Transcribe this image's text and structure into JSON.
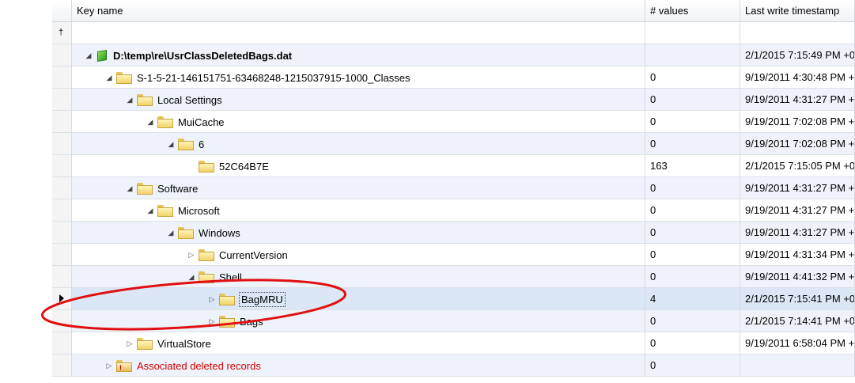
{
  "columns": {
    "key_name": "Key name",
    "values": "# values",
    "timestamp": "Last write timestamp"
  },
  "filter_row": {
    "pin_glyph": "†"
  },
  "rows": [
    {
      "label": "D:\\temp\\re\\UsrClassDeletedBags.dat",
      "values": "",
      "timestamp": "2/1/2015 7:15:49 PM +0...",
      "level": 0,
      "expander": "open",
      "icon": "hive-icon",
      "bold": true,
      "red": false,
      "band": true,
      "selected": false
    },
    {
      "label": "S-1-5-21-146151751-63468248-1215037915-1000_Classes",
      "values": "0",
      "timestamp": "9/19/2011 4:30:48 PM +...",
      "level": 1,
      "expander": "open",
      "icon": "folder-icon",
      "bold": false,
      "red": false,
      "band": false,
      "selected": false
    },
    {
      "label": "Local Settings",
      "values": "0",
      "timestamp": "9/19/2011 4:31:27 PM +...",
      "level": 2,
      "expander": "open",
      "icon": "folder-icon",
      "bold": false,
      "red": false,
      "band": true,
      "selected": false
    },
    {
      "label": "MuiCache",
      "values": "0",
      "timestamp": "9/19/2011 7:02:08 PM +...",
      "level": 3,
      "expander": "open",
      "icon": "folder-icon",
      "bold": false,
      "red": false,
      "band": false,
      "selected": false
    },
    {
      "label": "6",
      "values": "0",
      "timestamp": "9/19/2011 7:02:08 PM +...",
      "level": 4,
      "expander": "open",
      "icon": "folder-icon",
      "bold": false,
      "red": false,
      "band": true,
      "selected": false
    },
    {
      "label": "52C64B7E",
      "values": "163",
      "timestamp": "2/1/2015 7:15:05 PM +0...",
      "level": 5,
      "expander": "none",
      "icon": "folder-icon",
      "bold": false,
      "red": false,
      "band": false,
      "selected": false
    },
    {
      "label": "Software",
      "values": "0",
      "timestamp": "9/19/2011 4:31:27 PM +...",
      "level": 2,
      "expander": "open",
      "icon": "folder-icon",
      "bold": false,
      "red": false,
      "band": true,
      "selected": false
    },
    {
      "label": "Microsoft",
      "values": "0",
      "timestamp": "9/19/2011 4:31:27 PM +...",
      "level": 3,
      "expander": "open",
      "icon": "folder-icon",
      "bold": false,
      "red": false,
      "band": false,
      "selected": false
    },
    {
      "label": "Windows",
      "values": "0",
      "timestamp": "9/19/2011 4:31:27 PM +...",
      "level": 4,
      "expander": "open",
      "icon": "folder-icon",
      "bold": false,
      "red": false,
      "band": true,
      "selected": false
    },
    {
      "label": "CurrentVersion",
      "values": "0",
      "timestamp": "9/19/2011 4:31:34 PM +...",
      "level": 5,
      "expander": "closed",
      "icon": "folder-icon",
      "bold": false,
      "red": false,
      "band": false,
      "selected": false
    },
    {
      "label": "Shell",
      "values": "0",
      "timestamp": "9/19/2011 4:41:32 PM +...",
      "level": 5,
      "expander": "open",
      "icon": "folder-icon",
      "bold": false,
      "red": false,
      "band": true,
      "selected": false
    },
    {
      "label": "BagMRU",
      "values": "4",
      "timestamp": "2/1/2015 7:15:41 PM +0...",
      "level": 6,
      "expander": "closed",
      "icon": "folder-icon",
      "bold": false,
      "red": false,
      "band": false,
      "selected": true
    },
    {
      "label": "Bags",
      "values": "0",
      "timestamp": "2/1/2015 7:14:41 PM +0...",
      "level": 6,
      "expander": "closed",
      "icon": "folder-icon",
      "bold": false,
      "red": false,
      "band": true,
      "selected": false
    },
    {
      "label": "VirtualStore",
      "values": "0",
      "timestamp": "9/19/2011 6:58:04 PM +...",
      "level": 2,
      "expander": "closed",
      "icon": "folder-icon",
      "bold": false,
      "red": false,
      "band": false,
      "selected": false
    },
    {
      "label": "Associated deleted records",
      "values": "0",
      "timestamp": "",
      "level": 1,
      "expander": "closed",
      "icon": "warning-folder-icon",
      "bold": false,
      "red": true,
      "band": true,
      "selected": false
    }
  ],
  "colors": {
    "band": "#eef3fb",
    "selected": "#dbe7f6",
    "annotation": "#e01010",
    "deleted_text": "#d00000"
  }
}
